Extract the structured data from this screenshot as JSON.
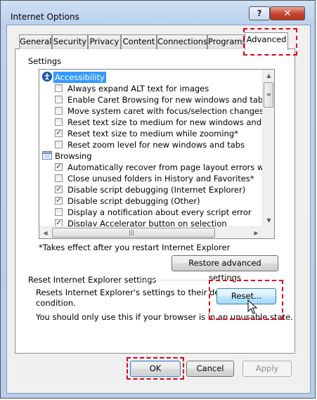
{
  "window": {
    "title": "Internet Options",
    "help_glyph": "?",
    "close_glyph": "✕"
  },
  "tabs": [
    {
      "label": "General",
      "active": false
    },
    {
      "label": "Security",
      "active": false
    },
    {
      "label": "Privacy",
      "active": false
    },
    {
      "label": "Content",
      "active": false
    },
    {
      "label": "Connections",
      "active": false
    },
    {
      "label": "Programs",
      "active": false
    },
    {
      "label": "Advanced",
      "active": true
    }
  ],
  "settings": {
    "label": "Settings",
    "categories": [
      {
        "label": "Accessibility",
        "icon": "accessibility-icon",
        "selected": true,
        "items": [
          {
            "label": "Always expand ALT text for images",
            "checked": false
          },
          {
            "label": "Enable Caret Browsing for new windows and tabs",
            "checked": false
          },
          {
            "label": "Move system caret with focus/selection changes",
            "checked": false
          },
          {
            "label": "Reset text size to medium for new windows and tabs",
            "checked": false
          },
          {
            "label": "Reset text size to medium while zooming*",
            "checked": true
          },
          {
            "label": "Reset zoom level for new windows and tabs",
            "checked": false
          }
        ]
      },
      {
        "label": "Browsing",
        "icon": "browsing-icon",
        "selected": false,
        "items": [
          {
            "label": "Automatically recover from page layout errors with Compa",
            "checked": true
          },
          {
            "label": "Close unused folders in History and Favorites*",
            "checked": false
          },
          {
            "label": "Disable script debugging (Internet Explorer)",
            "checked": true
          },
          {
            "label": "Disable script debugging (Other)",
            "checked": true
          },
          {
            "label": "Display a notification about every script error",
            "checked": false
          },
          {
            "label": "Display Accelerator button on selection",
            "checked": true
          }
        ]
      }
    ],
    "footnote": "*Takes effect after you restart Internet Explorer",
    "restore_button": "Restore advanced settings"
  },
  "reset_section": {
    "label": "Reset Internet Explorer settings",
    "description_line1": "Resets Internet Explorer's settings to their default",
    "description_line2": "condition.",
    "warning": "You should only use this if your browser is in an unusable state.",
    "reset_button": "Reset..."
  },
  "footer": {
    "ok": "OK",
    "cancel": "Cancel",
    "apply": "Apply"
  },
  "colors": {
    "highlight": "#e0001b",
    "selection": "#3399ff"
  }
}
